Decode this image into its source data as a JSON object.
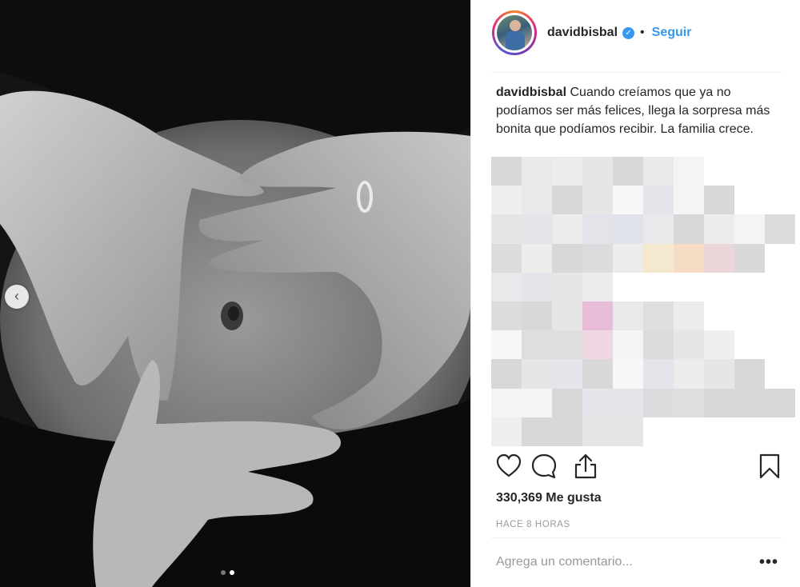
{
  "post": {
    "username": "davidbisbal",
    "verified_icon": "verified-badge-icon",
    "bullet": "•",
    "follow_label": "Seguir",
    "caption_user": "davidbisbal",
    "caption_text": "Cuando creíamos que ya no podíamos ser más felices, llega la sorpresa más bonita que podíamos recibir. La familia crece.",
    "likes": "330,369 Me gusta",
    "time_ago": "HACE 8 HORAS",
    "comment_placeholder": "Agrega un comentario...",
    "more_label": "•••"
  },
  "carousel": {
    "prev_icon": "chevron-left-icon",
    "prev_glyph": "‹",
    "slide_count": 2,
    "active_slide": 2
  },
  "actions": {
    "like_icon": "heart-icon",
    "comment_icon": "comment-bubble-icon",
    "share_icon": "share-icon",
    "save_icon": "bookmark-icon"
  },
  "colors": {
    "accent": "#3897f0",
    "text": "#262626",
    "muted": "#999999"
  }
}
